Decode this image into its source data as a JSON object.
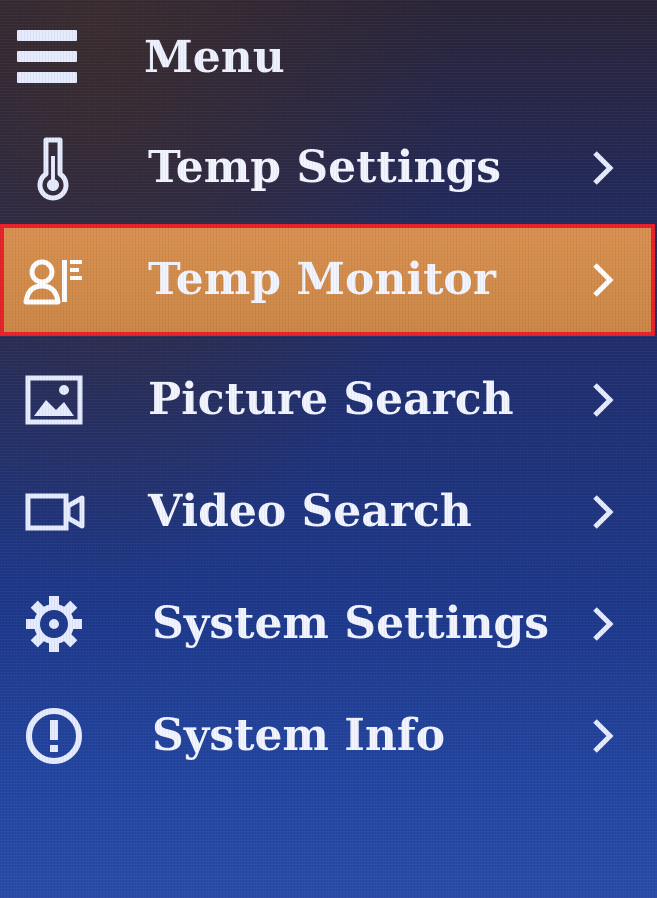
{
  "header": {
    "title": "Menu",
    "icon": "hamburger-menu-icon"
  },
  "menu": {
    "items": [
      {
        "label": "Temp Settings",
        "icon": "thermometer-icon",
        "selected": false
      },
      {
        "label": "Temp Monitor",
        "icon": "person-monitor-icon",
        "selected": true
      },
      {
        "label": "Picture Search",
        "icon": "picture-icon",
        "selected": false
      },
      {
        "label": "Video Search",
        "icon": "video-camera-icon",
        "selected": false
      },
      {
        "label": "System Settings",
        "icon": "gear-icon",
        "selected": false
      },
      {
        "label": "System Info",
        "icon": "info-exclamation-icon",
        "selected": false
      }
    ]
  },
  "colors": {
    "selected_fill": "#d68c4c",
    "selected_border": "#e8212b",
    "text": "#f2f5ff"
  }
}
